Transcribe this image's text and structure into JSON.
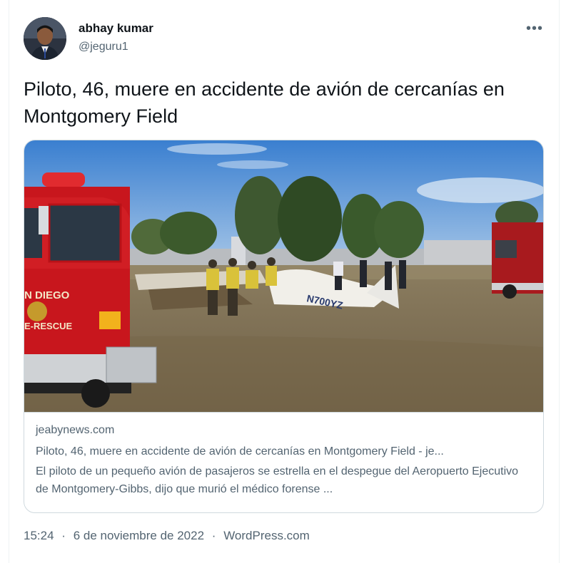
{
  "user": {
    "display_name": "abhay kumar",
    "handle": "@jeguru1",
    "avatar_icon": "user-avatar"
  },
  "more_icon": "more-horizontal-icon",
  "tweet": {
    "text": "Piloto, 46, muere en accidente de avión de cercanías en Montgomery Field"
  },
  "card": {
    "image_sign_text": "N DIEGO",
    "image_sign_text2": "E-RESCUE",
    "image_tail_number": "N700YZ",
    "domain": "jeabynews.com",
    "title": "Piloto, 46, muere en accidente de avión de cercanías en Montgomery Field - je...",
    "description": "El piloto de un pequeño avión de pasajeros se estrella en el despegue del Aeropuerto Ejecutivo de Montgomery-Gibbs, dijo que murió el médico forense ..."
  },
  "footer": {
    "time": "15:24",
    "date": "6 de noviembre de 2022",
    "source": "WordPress.com",
    "separator": "·"
  },
  "colors": {
    "text_primary": "#0f1419",
    "text_secondary": "#536471",
    "border": "#cfd9de",
    "fire_truck_red": "#c8161d",
    "sky_blue": "#3f86d6",
    "dirt": "#8a7a5c"
  }
}
